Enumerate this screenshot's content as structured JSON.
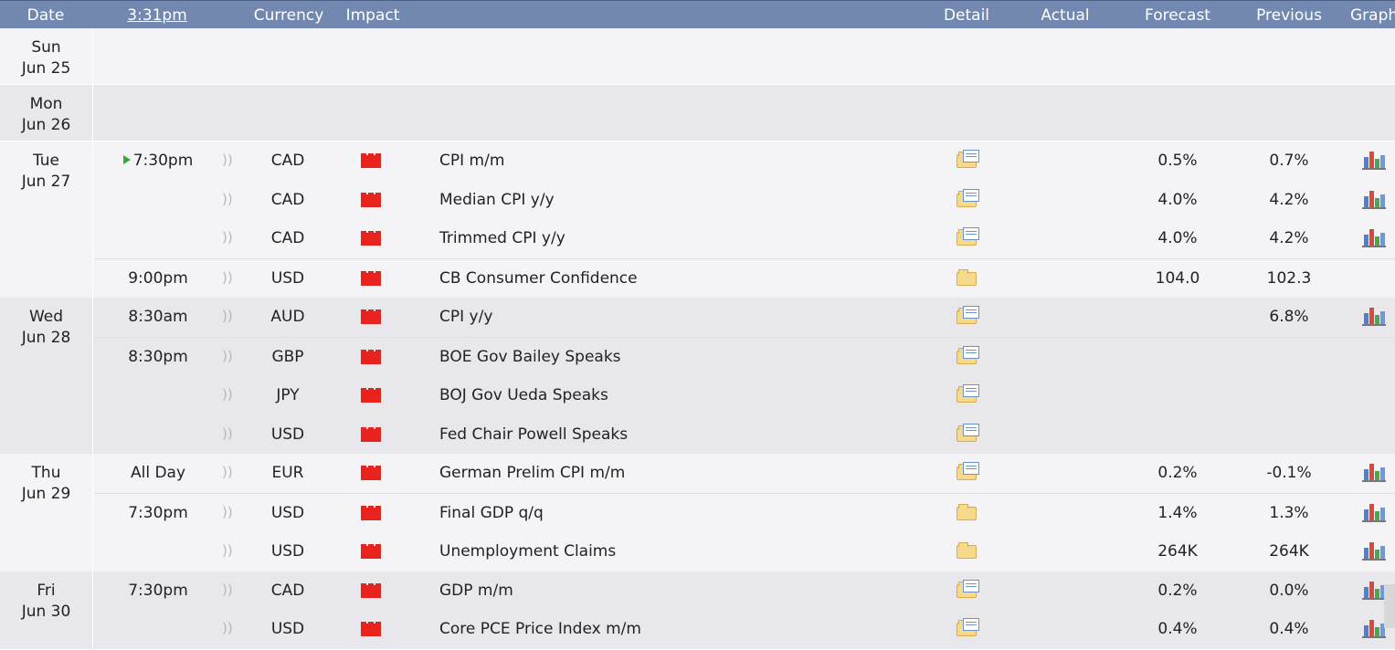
{
  "header": {
    "date": "Date",
    "time": "3:31pm",
    "currency": "Currency",
    "impact": "Impact",
    "detail": "Detail",
    "actual": "Actual",
    "forecast": "Forecast",
    "previous": "Previous",
    "graph": "Graph"
  },
  "colors": {
    "header_bg": "#7288b0",
    "impact_high": "#e8221c",
    "row_alt": "#e8e8ec",
    "row": "#f4f4f7"
  },
  "days": [
    {
      "day": "Sun",
      "date": "Jun 25",
      "events": []
    },
    {
      "day": "Mon",
      "date": "Jun 26",
      "events": []
    },
    {
      "day": "Tue",
      "date": "Jun 27",
      "events": [
        {
          "time": "7:30pm",
          "next": true,
          "currency": "CAD",
          "impact": "high",
          "name": "CPI m/m",
          "detail": "doc",
          "actual": "",
          "forecast": "0.5%",
          "previous": "0.7%",
          "graph": true
        },
        {
          "time": "",
          "currency": "CAD",
          "impact": "high",
          "name": "Median CPI y/y",
          "detail": "doc",
          "actual": "",
          "forecast": "4.0%",
          "previous": "4.2%",
          "graph": true
        },
        {
          "time": "",
          "currency": "CAD",
          "impact": "high",
          "name": "Trimmed CPI y/y",
          "detail": "doc",
          "actual": "",
          "forecast": "4.0%",
          "previous": "4.2%",
          "graph": true
        },
        {
          "time": "9:00pm",
          "currency": "USD",
          "impact": "high",
          "name": "CB Consumer Confidence",
          "detail": "folder",
          "actual": "",
          "forecast": "104.0",
          "previous": "102.3",
          "graph": false
        }
      ]
    },
    {
      "day": "Wed",
      "date": "Jun 28",
      "events": [
        {
          "time": "8:30am",
          "currency": "AUD",
          "impact": "high",
          "name": "CPI y/y",
          "detail": "doc",
          "actual": "",
          "forecast": "",
          "previous": "6.8%",
          "graph": true
        },
        {
          "time": "8:30pm",
          "currency": "GBP",
          "impact": "high",
          "name": "BOE Gov Bailey Speaks",
          "detail": "doc",
          "actual": "",
          "forecast": "",
          "previous": "",
          "graph": false
        },
        {
          "time": "",
          "currency": "JPY",
          "impact": "high",
          "name": "BOJ Gov Ueda Speaks",
          "detail": "doc",
          "actual": "",
          "forecast": "",
          "previous": "",
          "graph": false
        },
        {
          "time": "",
          "currency": "USD",
          "impact": "high",
          "name": "Fed Chair Powell Speaks",
          "detail": "doc",
          "actual": "",
          "forecast": "",
          "previous": "",
          "graph": false
        }
      ]
    },
    {
      "day": "Thu",
      "date": "Jun 29",
      "events": [
        {
          "time": "All Day",
          "currency": "EUR",
          "impact": "high",
          "name": "German Prelim CPI m/m",
          "detail": "doc",
          "actual": "",
          "forecast": "0.2%",
          "previous": "-0.1%",
          "graph": true
        },
        {
          "time": "7:30pm",
          "currency": "USD",
          "impact": "high",
          "name": "Final GDP q/q",
          "detail": "folder",
          "actual": "",
          "forecast": "1.4%",
          "previous": "1.3%",
          "graph": true
        },
        {
          "time": "",
          "currency": "USD",
          "impact": "high",
          "name": "Unemployment Claims",
          "detail": "folder",
          "actual": "",
          "forecast": "264K",
          "previous": "264K",
          "graph": true
        }
      ]
    },
    {
      "day": "Fri",
      "date": "Jun 30",
      "events": [
        {
          "time": "7:30pm",
          "currency": "CAD",
          "impact": "high",
          "name": "GDP m/m",
          "detail": "doc",
          "actual": "",
          "forecast": "0.2%",
          "previous": "0.0%",
          "graph": true
        },
        {
          "time": "",
          "currency": "USD",
          "impact": "high",
          "name": "Core PCE Price Index m/m",
          "detail": "doc",
          "actual": "",
          "forecast": "0.4%",
          "previous": "0.4%",
          "graph": true
        }
      ]
    }
  ]
}
